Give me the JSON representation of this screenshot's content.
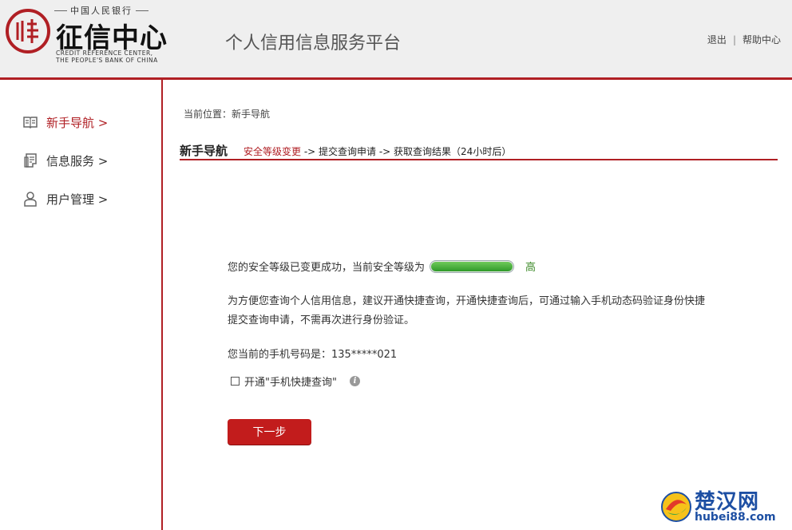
{
  "header": {
    "bank_name": "中国人民银行",
    "logo_title": "征信中心",
    "logo_en_line1": "CREDIT REFERENCE CENTER,",
    "logo_en_line2": "THE PEOPLE'S BANK OF CHINA",
    "platform_title": "个人信用信息服务平台",
    "logout_label": "退出",
    "separator": "|",
    "help_label": "帮助中心",
    "accent_color": "#b01f24"
  },
  "sidebar": {
    "items": [
      {
        "label": "新手导航 >",
        "icon": "book-icon",
        "active": true
      },
      {
        "label": "信息服务 >",
        "icon": "document-icon",
        "active": false
      },
      {
        "label": "用户管理 >",
        "icon": "user-icon",
        "active": false
      }
    ]
  },
  "main": {
    "breadcrumb": "当前位置：新手导航",
    "guide_title": "新手导航",
    "steps": {
      "current": "安全等级变更",
      "rest": " -> 提交查询申请 -> 获取查询结果（24小时后）"
    },
    "security_msg": "您的安全等级已变更成功，当前安全等级为",
    "security_level": "高",
    "security_level_fraction": 1.0,
    "advice_text": "为方便您查询个人信用信息，建议开通快捷查询，开通快捷查询后，可通过输入手机动态码验证身份快捷提交查询申请，不需再次进行身份验证。",
    "phone_text": "您当前的手机号码是：135*****021",
    "quick_query_label": "开通\"手机快捷查询\"",
    "quick_query_checked": false,
    "info_icon_glyph": "i",
    "next_button": "下一步"
  },
  "watermark": {
    "cn": "楚汉网",
    "en": "hubei88.com"
  }
}
